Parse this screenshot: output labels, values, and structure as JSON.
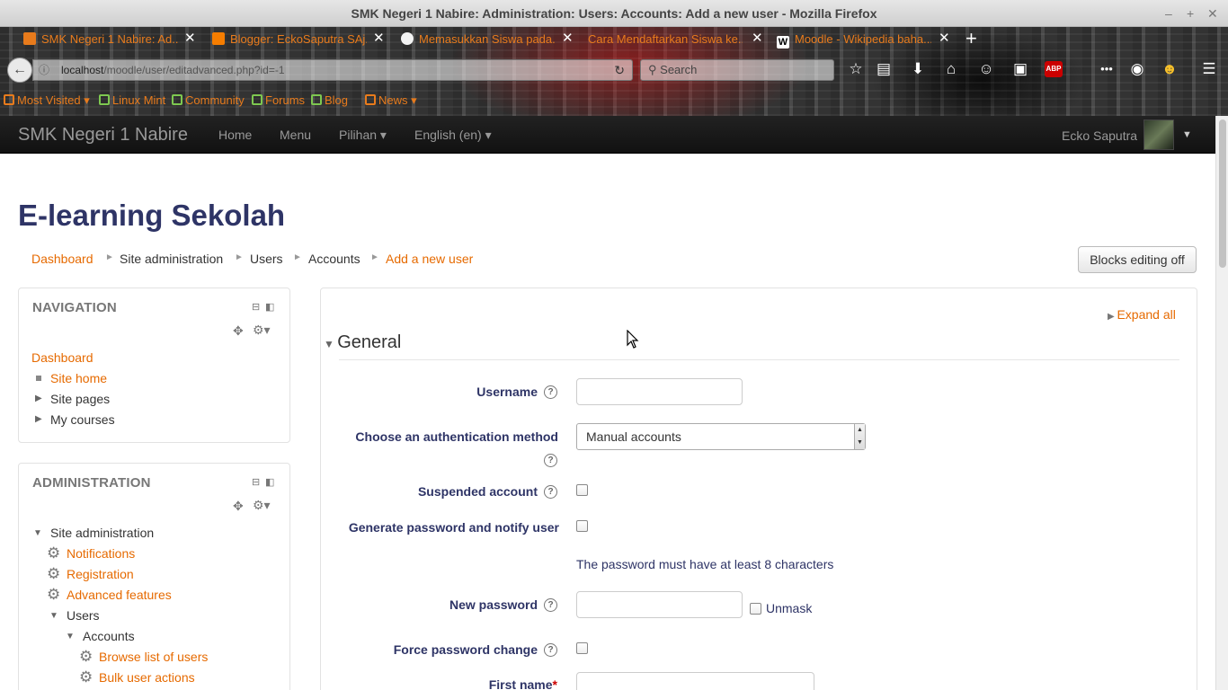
{
  "window": {
    "title": "SMK Negeri 1 Nabire: Administration: Users: Accounts: Add a new user - Mozilla Firefox"
  },
  "browser": {
    "tabs": [
      {
        "label": "SMK Negeri 1 Nabire: Ad..."
      },
      {
        "label": "Blogger: EckoSaputra SAj..."
      },
      {
        "label": "Memasukkan Siswa pada..."
      },
      {
        "label": "Cara Mendaftarkan Siswa ke..."
      },
      {
        "label": "Moodle - Wikipedia baha..."
      }
    ],
    "url_host": "localhost",
    "url_path": "/moodle/user/editadvanced.php?id=-1",
    "search_placeholder": "Search",
    "bookmarks": [
      "Most Visited",
      "Linux Mint",
      "Community",
      "Forums",
      "Blog",
      "News"
    ]
  },
  "site": {
    "brand": "SMK Negeri 1 Nabire",
    "menu": [
      "Home",
      "Menu",
      "Pilihan ▾",
      "English (en) ▾"
    ],
    "user": "Ecko Saputra",
    "heading": "E-learning Sekolah"
  },
  "breadcrumb": [
    "Dashboard",
    "Site administration",
    "Users",
    "Accounts",
    "Add a new user"
  ],
  "blocks_editing_label": "Blocks editing off",
  "navigation": {
    "title": "NAVIGATION",
    "dashboard": "Dashboard",
    "items": [
      "Site home",
      "Site pages",
      "My courses"
    ]
  },
  "administration": {
    "title": "ADMINISTRATION",
    "site_admin": "Site administration",
    "items": [
      "Notifications",
      "Registration",
      "Advanced features"
    ],
    "users": "Users",
    "accounts": "Accounts",
    "account_items": [
      "Browse list of users",
      "Bulk user actions"
    ]
  },
  "form": {
    "expand_all": "Expand all",
    "section": "General",
    "username_label": "Username",
    "auth_label": "Choose an authentication method",
    "auth_value": "Manual accounts",
    "suspended_label": "Suspended account",
    "generate_label": "Generate password and notify user",
    "password_note": "The password must have at least 8 characters",
    "new_password_label": "New password",
    "unmask_label": "Unmask",
    "force_change_label": "Force password change",
    "first_name_label": "First name",
    "required_mark": "*"
  }
}
